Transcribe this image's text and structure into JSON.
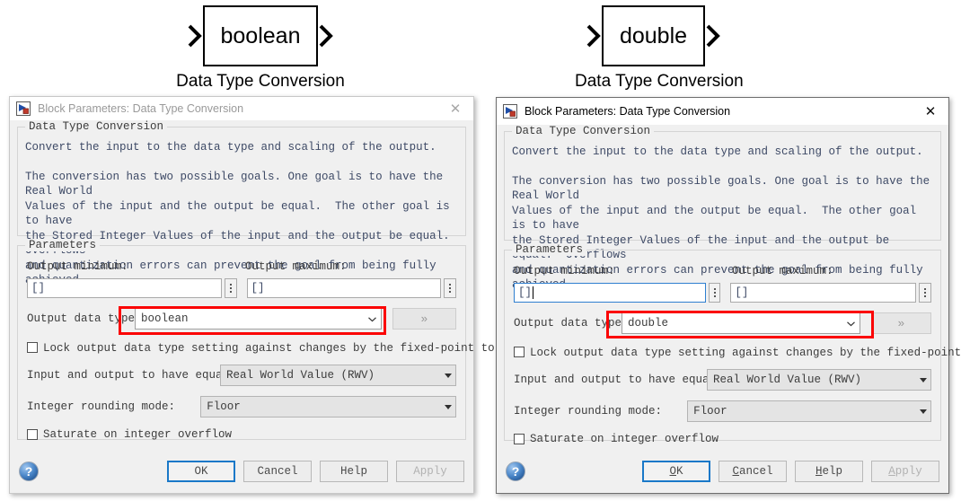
{
  "blocks": [
    {
      "label": "boolean",
      "caption": "Data Type Conversion",
      "in_port_icon": "input-port-arrow-icon",
      "out_port_icon": "output-port-arrow-icon"
    },
    {
      "label": "double",
      "caption": "Data Type Conversion",
      "in_port_icon": "input-port-arrow-icon",
      "out_port_icon": "output-port-arrow-icon"
    }
  ],
  "dialogs": [
    {
      "state": "inactive",
      "title": "Block Parameters: Data Type Conversion",
      "title_icon": "simulink-block-icon",
      "close_icon": "close-icon",
      "description_group": {
        "legend": "Data Type Conversion",
        "paragraphs": [
          "Convert the input to the data type and scaling of the output.",
          "The conversion has two possible goals. One goal is to have the Real World\nValues of the input and the output be equal.  The other goal is to have\nthe Stored Integer Values of the input and the output be equal.  Overflows\nand quantization errors can prevent the goal from being fully achieved."
        ]
      },
      "parameters_group": {
        "legend": "Parameters",
        "output_minimum_label": "Output minimum:",
        "output_minimum_value": "[]",
        "output_minimum_focused": false,
        "output_maximum_label": "Output maximum:",
        "output_maximum_value": "[]",
        "output_data_type_label": "Output data type",
        "output_data_type_value": "boolean",
        "expand_button_label": "»",
        "lock_checkbox_label": "Lock output data type setting against changes by the fixed-point to⋯",
        "lock_checked": false,
        "equal_label": "Input and output to have equal:",
        "equal_value": "Real World Value (RWV)",
        "rounding_label": "Integer rounding mode:",
        "rounding_value": "Floor",
        "saturate_label": "Saturate on integer overflow",
        "saturate_checked": false
      },
      "footer": {
        "help_icon": "help-circle-icon",
        "ok_label": "OK",
        "cancel_label": "Cancel",
        "help_label": "Help",
        "apply_label": "Apply",
        "mnemonics": false
      }
    },
    {
      "state": "active",
      "title": "Block Parameters: Data Type Conversion",
      "title_icon": "simulink-block-icon",
      "close_icon": "close-icon",
      "description_group": {
        "legend": "Data Type Conversion",
        "paragraphs": [
          "Convert the input to the data type and scaling of the output.",
          "The conversion has two possible goals. One goal is to have the Real World\nValues of the input and the output be equal.  The other goal is to have\nthe Stored Integer Values of the input and the output be equal.  Overflows\nand quantization errors can prevent the goal from being fully achieved."
        ]
      },
      "parameters_group": {
        "legend": "Parameters",
        "output_minimum_label": "Output minimum:",
        "output_minimum_value": "[]",
        "output_minimum_focused": true,
        "output_maximum_label": "Output maximum:",
        "output_maximum_value": "[]",
        "output_data_type_label": "Output data type",
        "output_data_type_value": "double",
        "expand_button_label": "»",
        "lock_checkbox_label": "Lock output data type setting against changes by the fixed-point to⋯",
        "lock_checked": false,
        "equal_label": "Input and output to have equal:",
        "equal_value": "Real World Value (RWV)",
        "rounding_label": "Integer rounding mode:",
        "rounding_value": "Floor",
        "saturate_label": "Saturate on integer overflow",
        "saturate_checked": false
      },
      "footer": {
        "help_icon": "help-circle-icon",
        "ok_label": "OK",
        "cancel_label": "Cancel",
        "help_label": "Help",
        "apply_label": "Apply",
        "mnemonics": true
      }
    }
  ],
  "colors": {
    "highlight_red": "#fb0505",
    "focus_blue": "#1a78c8",
    "dialog_bg": "#f0f0f0",
    "desc_text": "#3e4a66"
  }
}
